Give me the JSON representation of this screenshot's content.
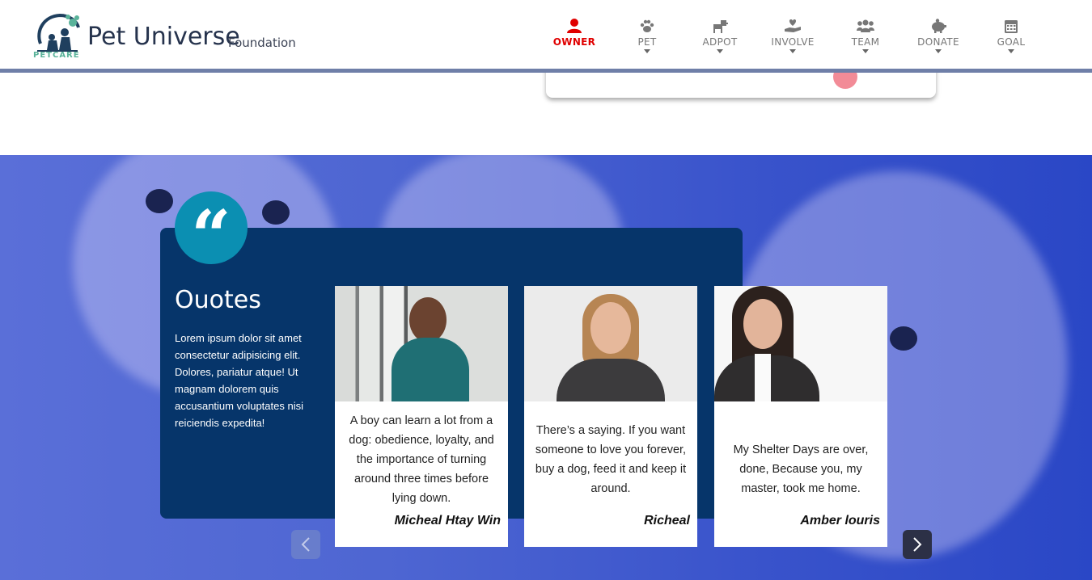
{
  "brand": {
    "logo_text": "PETCARE",
    "name": "Pet Universe",
    "subtitle": "Foundation"
  },
  "nav": [
    {
      "label": "OWNER",
      "icon": "user-icon",
      "active": true
    },
    {
      "label": "PET",
      "icon": "paw-icon"
    },
    {
      "label": "ADPOT",
      "icon": "dog-icon"
    },
    {
      "label": "INVOLVE",
      "icon": "hand-heart-icon"
    },
    {
      "label": "TEAM",
      "icon": "users-icon"
    },
    {
      "label": "DONATE",
      "icon": "piggy-bank-icon"
    },
    {
      "label": "GOAL",
      "icon": "calendar-icon"
    }
  ],
  "quotes": {
    "badge_glyph": "“",
    "title": "Ouotes",
    "text": "Lorem ipsum dolor sit amet consectetur adipisicing elit. Dolores, pariatur atque! Ut magnam dolorem quis accusantium voluptates nisi reiciendis expedita!",
    "cards": [
      {
        "quote": "A boy can learn a lot from a dog: obedience, loyalty, and the importance of turning around three times before lying down.",
        "name": "Micheal Htay Win"
      },
      {
        "quote": "There’s a saying. If you want someone to love you forever, buy a dog, feed it and keep it around.",
        "name": "Richeal"
      },
      {
        "quote": "My Shelter Days are over, done, Because you, my master, took me home.",
        "name": "Amber louris"
      }
    ]
  },
  "colors": {
    "active_nav": "#e00000",
    "panel": "#06356a",
    "badge": "#0b8fb2"
  }
}
